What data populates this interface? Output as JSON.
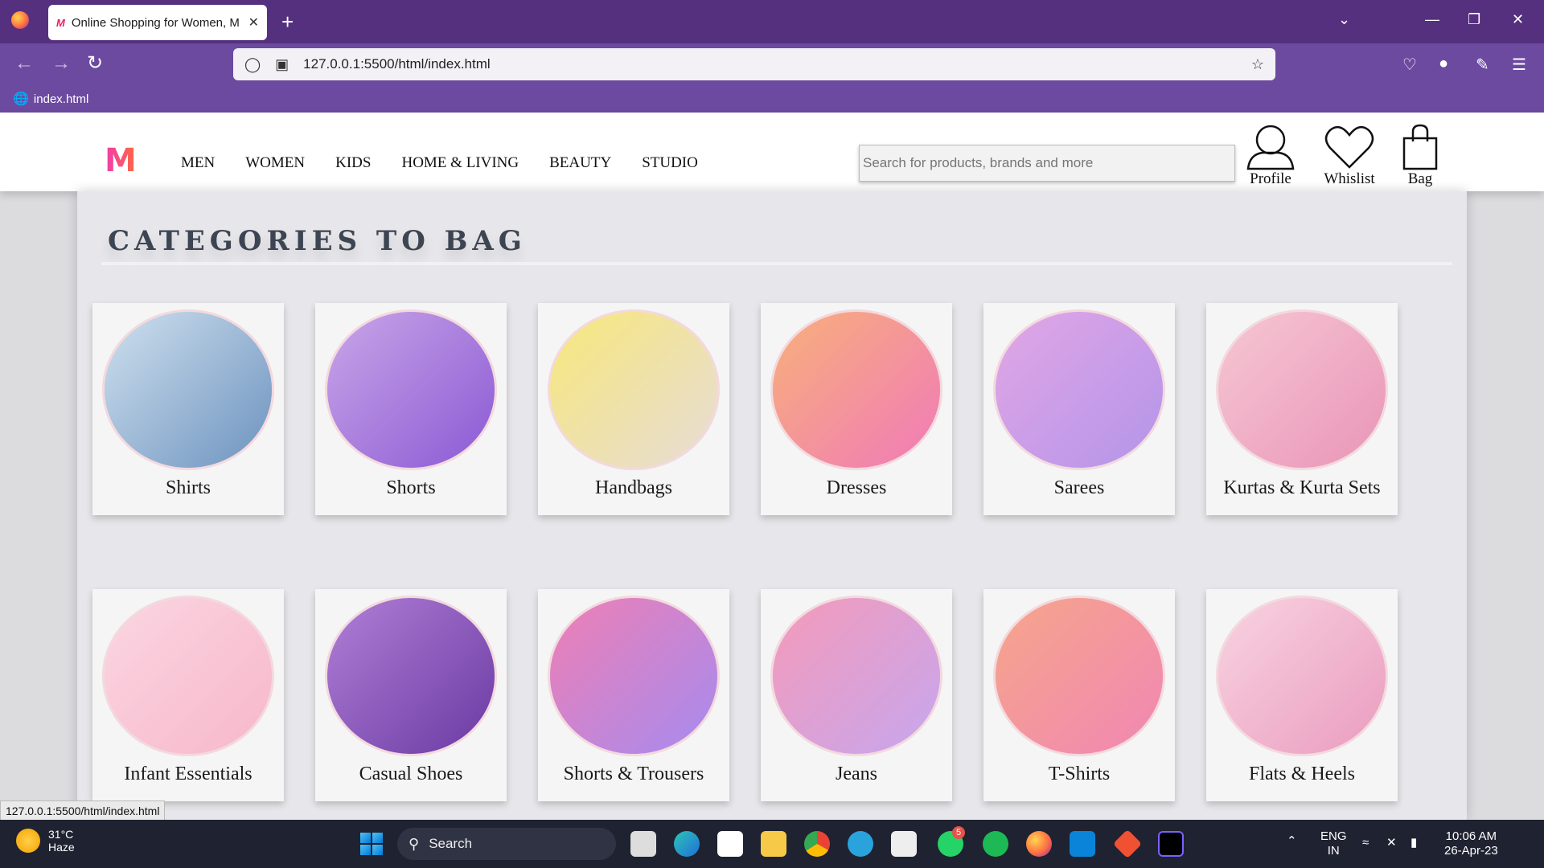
{
  "browser": {
    "tab_title": "Online Shopping for Women, M",
    "tab_favicon": "M",
    "close_glyph": "✕",
    "new_tab_glyph": "+",
    "url": "127.0.0.1:5500/html/index.html",
    "bookmark": "index.html",
    "status_url": "127.0.0.1:5500/html/index.html",
    "icons": [
      "firefox-icon",
      "back-icon",
      "forward-icon",
      "reload-icon",
      "shield-icon",
      "page-icon",
      "star-icon",
      "pocket-icon",
      "account-icon",
      "extensions-icon",
      "menu-icon",
      "tab-list-icon",
      "minimize-icon",
      "restore-icon",
      "window-close-icon"
    ]
  },
  "header": {
    "logo": "M",
    "menu": [
      "MEN",
      "WOMEN",
      "KIDS",
      "HOME & LIVING",
      "BEAUTY",
      "STUDIO"
    ],
    "search_placeholder": "Search for products, brands and more",
    "actions": [
      "Profile",
      "Whislist",
      "Bag"
    ]
  },
  "main": {
    "heading": "CATEGORIES TO BAG",
    "categories": [
      {
        "label": "Shirts",
        "bg": [
          "#cfe0ee",
          "#6d93bf"
        ]
      },
      {
        "label": "Shorts",
        "bg": [
          "#c9a6e8",
          "#8a59d4"
        ]
      },
      {
        "label": "Handbags",
        "bg": [
          "#f7e87a",
          "#e7dcd8"
        ]
      },
      {
        "label": "Dresses",
        "bg": [
          "#f8b07a",
          "#f07ab9"
        ]
      },
      {
        "label": "Sarees",
        "bg": [
          "#e2a6e6",
          "#b395e9"
        ]
      },
      {
        "label": "Kurtas & Kurta Sets",
        "bg": [
          "#f6c7d4",
          "#e995b7"
        ]
      },
      {
        "label": "Infant Essentials",
        "bg": [
          "#fbd6e2",
          "#f7b7cb"
        ]
      },
      {
        "label": "Casual Shoes",
        "bg": [
          "#b07fd6",
          "#6a3aa3"
        ]
      },
      {
        "label": "Shorts & Trousers",
        "bg": [
          "#ef7fb4",
          "#a58bf0"
        ]
      },
      {
        "label": "Jeans",
        "bg": [
          "#f59ab9",
          "#c6a7ef"
        ]
      },
      {
        "label": "T-Shirts",
        "bg": [
          "#f6a58a",
          "#f187b4"
        ]
      },
      {
        "label": "Flats & Heels",
        "bg": [
          "#f8d3e0",
          "#ea9cc0"
        ]
      }
    ]
  },
  "taskbar": {
    "temperature": "31°C",
    "weather": "Haze",
    "search_label": "Search",
    "language": "ENG",
    "region": "IN",
    "time": "10:06 AM",
    "date": "26-Apr-23",
    "whatsapp_badge": "5"
  }
}
